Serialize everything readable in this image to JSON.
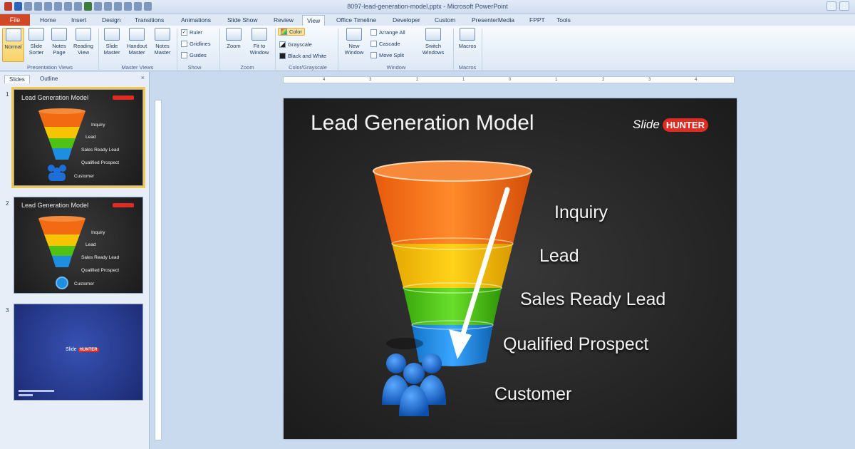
{
  "window": {
    "title": "8097-lead-generation-model.pptx - Microsoft PowerPoint"
  },
  "ribbon_tabs": {
    "file": "File",
    "tabs": [
      "Home",
      "Insert",
      "Design",
      "Transitions",
      "Animations",
      "Slide Show",
      "Review",
      "View",
      "Office Timeline",
      "Developer",
      "Custom",
      "PresenterMedia",
      "FPPT",
      "Tools"
    ],
    "active": "View"
  },
  "ribbon": {
    "presentation_views": {
      "group": "Presentation Views",
      "buttons": [
        "Normal",
        "Slide Sorter",
        "Notes Page",
        "Reading View"
      ]
    },
    "master_views": {
      "group": "Master Views",
      "buttons": [
        "Slide Master",
        "Handout Master",
        "Notes Master"
      ]
    },
    "show": {
      "group": "Show",
      "ruler": "Ruler",
      "gridlines": "Gridlines",
      "guides": "Guides",
      "ruler_checked": true
    },
    "zoom": {
      "group": "Zoom",
      "zoom": "Zoom",
      "fit": "Fit to Window"
    },
    "color_grayscale": {
      "group": "Color/Grayscale",
      "color": "Color",
      "grayscale": "Grayscale",
      "bw": "Black and White"
    },
    "window": {
      "group": "Window",
      "new_window": "New Window",
      "arrange_all": "Arrange All",
      "cascade": "Cascade",
      "move_split": "Move Split",
      "switch_windows": "Switch Windows"
    },
    "macros": {
      "group": "Macros",
      "macros": "Macros"
    }
  },
  "left_panel": {
    "tabs": [
      "Slides",
      "Outline"
    ],
    "close": "×",
    "slides": [
      {
        "number": "1",
        "title": "Lead Generation Model"
      },
      {
        "number": "2",
        "title": "Lead Generation Model"
      },
      {
        "number": "3"
      }
    ],
    "thumb_labels": [
      "Inquiry",
      "Lead",
      "Sales Ready Lead",
      "Qualified Prospect",
      "Customer"
    ],
    "thumb3_logo": {
      "slide": "Slide",
      "hunter": "HUNTER"
    }
  },
  "slide": {
    "title": "Lead Generation Model",
    "logo": {
      "slide": "Slide",
      "hunter": "HUNTER"
    },
    "labels": [
      "Inquiry",
      "Lead",
      "Sales Ready Lead",
      "Qualified Prospect",
      "Customer"
    ]
  },
  "colors": {
    "funnel": [
      "#f26a12",
      "#f6c400",
      "#4ec315",
      "#1e8fe0"
    ],
    "accent_red": "#e02b22",
    "file_tab": "#d24726",
    "people": "#1b6fd6"
  },
  "ruler_numbers": [
    "4",
    "3",
    "2",
    "1",
    "0",
    "1",
    "2",
    "3",
    "4"
  ]
}
